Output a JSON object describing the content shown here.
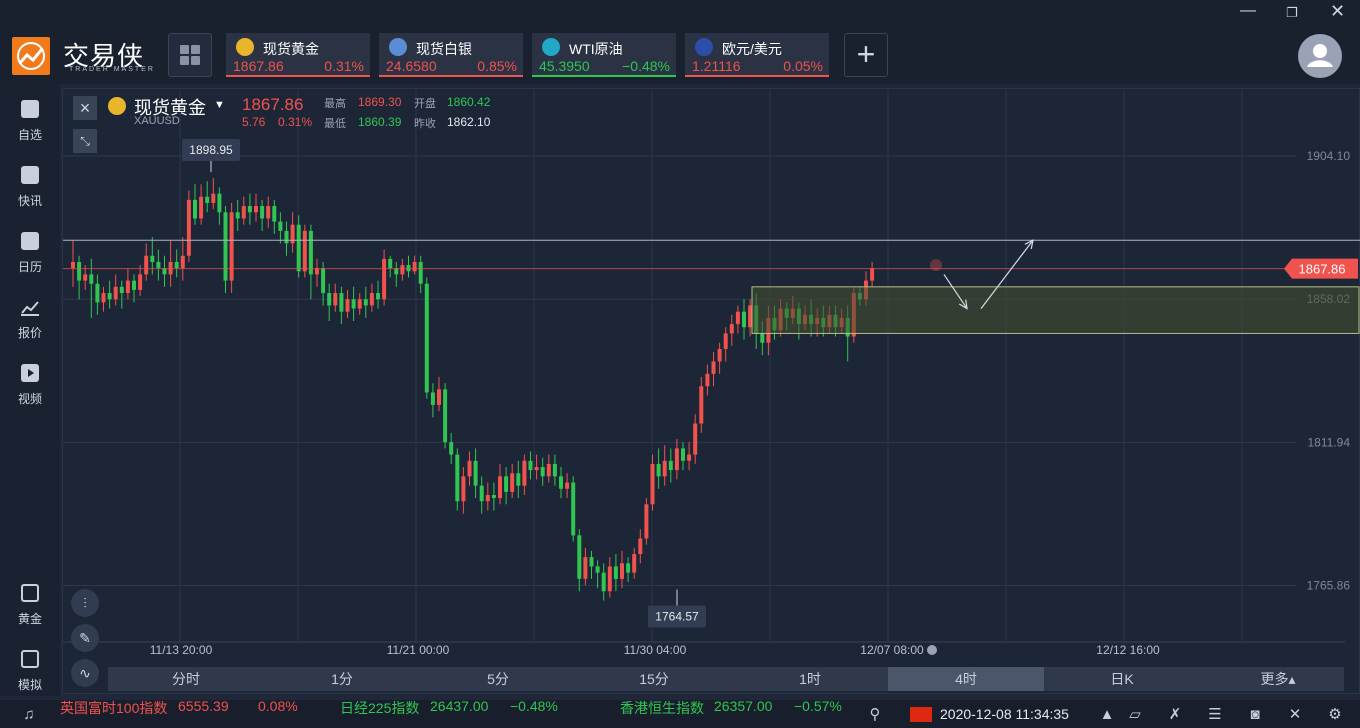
{
  "app": {
    "logo_text": "交易侠",
    "logo_sub": "TRADER MASTER",
    "window_controls": [
      "minimize-icon",
      "restore-icon",
      "close-icon"
    ]
  },
  "colors": {
    "up": "#f0524d",
    "down": "#2fc652",
    "accent": "#f07a1c",
    "bg": "#1f2738"
  },
  "tickers": [
    {
      "name": "现货黄金",
      "price": "1867.86",
      "change": "0.31%",
      "dir": "up",
      "icon": "gold-coin-icon"
    },
    {
      "name": "现货白银",
      "price": "24.6580",
      "change": "0.85%",
      "dir": "up",
      "icon": "silver-coin-icon"
    },
    {
      "name": "WTI原油",
      "price": "45.3950",
      "change": "−0.48%",
      "dir": "down",
      "icon": "oil-drum-icon"
    },
    {
      "name": "欧元/美元",
      "price": "1.21116",
      "change": "0.05%",
      "dir": "up",
      "icon": "eu-flag-icon"
    }
  ],
  "sidebar": {
    "items": [
      {
        "label": "自选",
        "icon": "bookmark-star-icon"
      },
      {
        "label": "快讯",
        "icon": "news-icon"
      },
      {
        "label": "日历",
        "icon": "calendar-icon"
      },
      {
        "label": "报价",
        "icon": "trend-chart-icon"
      },
      {
        "label": "视频",
        "icon": "video-play-icon"
      }
    ],
    "bottom": [
      {
        "label": "黄金",
        "icon": "gold-bar-icon"
      },
      {
        "label": "模拟",
        "icon": "wallet-icon"
      }
    ]
  },
  "chart_header": {
    "symbol_name": "现货黄金",
    "symbol_code": "XAUUSD",
    "price": "1867.86",
    "change": "5.76",
    "change_pct": "0.31%",
    "high_label": "最高",
    "high": "1869.30",
    "open_label": "开盘",
    "open": "1860.42",
    "low_label": "最低",
    "low": "1860.39",
    "prev_close_label": "昨收",
    "prev_close": "1862.10"
  },
  "timeframes": [
    "分时",
    "1分",
    "5分",
    "15分",
    "1时",
    "4时",
    "日K",
    "更多▴"
  ],
  "active_timeframe": "4时",
  "status_tickers": [
    {
      "name": "英国富时100指数",
      "value": "6555.39",
      "change": "0.08%"
    },
    {
      "name": "日经225指数",
      "value": "26437.00",
      "change": "−0.48%"
    },
    {
      "name": "香港恒生指数",
      "value": "26357.00",
      "change": "−0.57%"
    }
  ],
  "status_time": "2020-12-08 11:34:35",
  "chart_data": {
    "type": "candlestick",
    "y_ticks": [
      "1904.10",
      "1858.02",
      "1811.94",
      "1765.86"
    ],
    "ylim": [
      1748,
      1926
    ],
    "x_ticks": [
      "11/13 20:00",
      "11/21 00:00",
      "11/30 04:00",
      "12/07 08:00",
      "12/12 16:00"
    ],
    "current_price": "1867.86",
    "high_marker": "1898.95",
    "low_marker": "1764.57",
    "resistance": 1877,
    "zone": [
      1847,
      1862
    ],
    "candles": [
      [
        1868,
        1870,
        1862,
        1877
      ],
      [
        1870,
        1864,
        1858,
        1872
      ],
      [
        1864,
        1866,
        1861,
        1869
      ],
      [
        1866,
        1863,
        1852,
        1871
      ],
      [
        1863,
        1857,
        1853,
        1866
      ],
      [
        1857,
        1860,
        1854,
        1862
      ],
      [
        1860,
        1858,
        1855,
        1864
      ],
      [
        1858,
        1862,
        1856,
        1866
      ],
      [
        1862,
        1860,
        1855,
        1864
      ],
      [
        1860,
        1864,
        1858,
        1868
      ],
      [
        1864,
        1861,
        1857,
        1866
      ],
      [
        1861,
        1866,
        1859,
        1869
      ],
      [
        1866,
        1872,
        1864,
        1876
      ],
      [
        1872,
        1870,
        1866,
        1878
      ],
      [
        1870,
        1868,
        1864,
        1874
      ],
      [
        1868,
        1866,
        1862,
        1872
      ],
      [
        1866,
        1870,
        1862,
        1877
      ],
      [
        1870,
        1868,
        1865,
        1874
      ],
      [
        1868,
        1872,
        1864,
        1878
      ],
      [
        1872,
        1890,
        1870,
        1893
      ],
      [
        1890,
        1884,
        1882,
        1895
      ],
      [
        1884,
        1891,
        1882,
        1895
      ],
      [
        1891,
        1889,
        1886,
        1896
      ],
      [
        1889,
        1892,
        1887,
        1897
      ],
      [
        1892,
        1886,
        1882,
        1894
      ],
      [
        1886,
        1864,
        1860,
        1888
      ],
      [
        1864,
        1886,
        1860,
        1889
      ],
      [
        1886,
        1884,
        1880,
        1890
      ],
      [
        1884,
        1888,
        1882,
        1891
      ],
      [
        1888,
        1886,
        1882,
        1892
      ],
      [
        1886,
        1888,
        1883,
        1892
      ],
      [
        1888,
        1884,
        1880,
        1890
      ],
      [
        1884,
        1888,
        1881,
        1891
      ],
      [
        1888,
        1883,
        1879,
        1890
      ],
      [
        1883,
        1880,
        1876,
        1886
      ],
      [
        1880,
        1876,
        1872,
        1883
      ],
      [
        1876,
        1882,
        1873,
        1886
      ],
      [
        1882,
        1867,
        1865,
        1885
      ],
      [
        1867,
        1880,
        1865,
        1882
      ],
      [
        1880,
        1866,
        1858,
        1882
      ],
      [
        1866,
        1868,
        1862,
        1871
      ],
      [
        1868,
        1860,
        1856,
        1870
      ],
      [
        1860,
        1856,
        1851,
        1863
      ],
      [
        1856,
        1860,
        1854,
        1863
      ],
      [
        1860,
        1854,
        1850,
        1862
      ],
      [
        1854,
        1858,
        1852,
        1861
      ],
      [
        1858,
        1855,
        1851,
        1862
      ],
      [
        1855,
        1858,
        1853,
        1860
      ],
      [
        1858,
        1856,
        1852,
        1862
      ],
      [
        1856,
        1860,
        1854,
        1863
      ],
      [
        1860,
        1858,
        1855,
        1864
      ],
      [
        1858,
        1871,
        1856,
        1874
      ],
      [
        1871,
        1868,
        1865,
        1872
      ],
      [
        1868,
        1866,
        1862,
        1870
      ],
      [
        1866,
        1869,
        1864,
        1871
      ],
      [
        1869,
        1867,
        1865,
        1872
      ],
      [
        1867,
        1870,
        1866,
        1872
      ],
      [
        1870,
        1863,
        1860,
        1872
      ],
      [
        1863,
        1828,
        1826,
        1865
      ],
      [
        1828,
        1824,
        1820,
        1831
      ],
      [
        1824,
        1829,
        1822,
        1833
      ],
      [
        1829,
        1812,
        1810,
        1831
      ],
      [
        1812,
        1808,
        1805,
        1815
      ],
      [
        1808,
        1793,
        1790,
        1810
      ],
      [
        1793,
        1801,
        1789,
        1804
      ],
      [
        1801,
        1806,
        1798,
        1809
      ],
      [
        1806,
        1798,
        1794,
        1810
      ],
      [
        1798,
        1793,
        1789,
        1801
      ],
      [
        1793,
        1795,
        1790,
        1799
      ],
      [
        1795,
        1794,
        1790,
        1799
      ],
      [
        1794,
        1801,
        1792,
        1805
      ],
      [
        1801,
        1796,
        1792,
        1804
      ],
      [
        1796,
        1802,
        1794,
        1805
      ],
      [
        1802,
        1798,
        1794,
        1806
      ],
      [
        1798,
        1806,
        1795,
        1808
      ],
      [
        1806,
        1803,
        1800,
        1809
      ],
      [
        1803,
        1804,
        1800,
        1808
      ],
      [
        1804,
        1801,
        1798,
        1807
      ],
      [
        1801,
        1805,
        1799,
        1808
      ],
      [
        1805,
        1801,
        1798,
        1808
      ],
      [
        1801,
        1797,
        1794,
        1804
      ],
      [
        1797,
        1799,
        1794,
        1802
      ],
      [
        1799,
        1782,
        1780,
        1801
      ],
      [
        1782,
        1768,
        1764,
        1784
      ],
      [
        1768,
        1775,
        1766,
        1778
      ],
      [
        1775,
        1772,
        1768,
        1777
      ],
      [
        1772,
        1770,
        1765,
        1774
      ],
      [
        1770,
        1764,
        1761,
        1773
      ],
      [
        1764,
        1772,
        1762,
        1775
      ],
      [
        1772,
        1768,
        1764,
        1776
      ],
      [
        1768,
        1773,
        1765,
        1777
      ],
      [
        1773,
        1770,
        1767,
        1775
      ],
      [
        1770,
        1776,
        1768,
        1778
      ],
      [
        1776,
        1781,
        1773,
        1784
      ],
      [
        1781,
        1792,
        1779,
        1794
      ],
      [
        1792,
        1805,
        1790,
        1808
      ],
      [
        1805,
        1801,
        1797,
        1810
      ],
      [
        1801,
        1806,
        1798,
        1811
      ],
      [
        1806,
        1803,
        1799,
        1810
      ],
      [
        1803,
        1810,
        1800,
        1813
      ],
      [
        1810,
        1806,
        1803,
        1812
      ],
      [
        1806,
        1808,
        1803,
        1812
      ],
      [
        1808,
        1818,
        1805,
        1821
      ],
      [
        1818,
        1830,
        1815,
        1833
      ],
      [
        1830,
        1834,
        1827,
        1837
      ],
      [
        1834,
        1838,
        1830,
        1841
      ],
      [
        1838,
        1842,
        1834,
        1844
      ],
      [
        1842,
        1847,
        1838,
        1849
      ],
      [
        1847,
        1850,
        1843,
        1853
      ],
      [
        1850,
        1854,
        1847,
        1856
      ],
      [
        1854,
        1849,
        1845,
        1858
      ],
      [
        1849,
        1856,
        1846,
        1858
      ],
      [
        1856,
        1847,
        1842,
        1860
      ],
      [
        1847,
        1844,
        1840,
        1851
      ],
      [
        1844,
        1852,
        1840,
        1856
      ],
      [
        1852,
        1848,
        1845,
        1856
      ],
      [
        1848,
        1855,
        1846,
        1858
      ],
      [
        1855,
        1852,
        1848,
        1857
      ],
      [
        1852,
        1855,
        1850,
        1859
      ],
      [
        1855,
        1850,
        1845,
        1857
      ],
      [
        1850,
        1853,
        1848,
        1856
      ],
      [
        1853,
        1850,
        1846,
        1858
      ],
      [
        1850,
        1852,
        1846,
        1855
      ],
      [
        1852,
        1849,
        1846,
        1856
      ],
      [
        1849,
        1853,
        1847,
        1856
      ],
      [
        1853,
        1849,
        1846,
        1856
      ],
      [
        1849,
        1852,
        1847,
        1855
      ],
      [
        1852,
        1846,
        1838,
        1856
      ],
      [
        1846,
        1860,
        1844,
        1862
      ],
      [
        1860,
        1858,
        1856,
        1862
      ],
      [
        1858,
        1864,
        1856,
        1867
      ],
      [
        1864,
        1868,
        1862,
        1870
      ]
    ]
  }
}
